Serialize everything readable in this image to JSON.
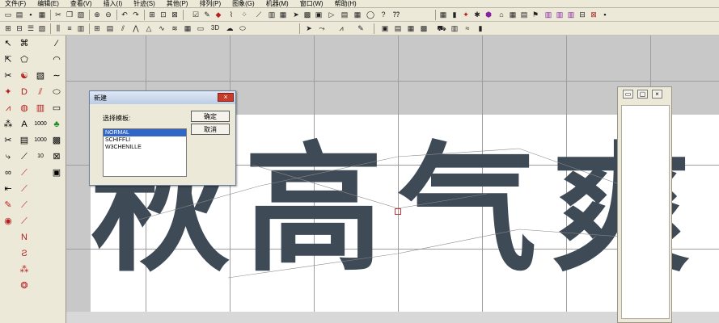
{
  "menu": [
    {
      "name": "menu-file",
      "label": "文件(F)"
    },
    {
      "name": "menu-edit",
      "label": "编辑(E)"
    },
    {
      "name": "menu-view",
      "label": "查看(V)"
    },
    {
      "name": "menu-insert",
      "label": "插入(I)"
    },
    {
      "name": "menu-stitch",
      "label": "针迹(S)"
    },
    {
      "name": "menu-other",
      "label": "其他(P)"
    },
    {
      "name": "menu-arrange",
      "label": "排列(P)"
    },
    {
      "name": "menu-image",
      "label": "图象(G)"
    },
    {
      "name": "menu-machine",
      "label": "机器(M)"
    },
    {
      "name": "menu-window",
      "label": "窗口(W)"
    },
    {
      "name": "menu-help",
      "label": "帮助(H)"
    }
  ],
  "toolbar2": {
    "threeD_label": "3D"
  },
  "lefttools": {
    "len_1000_a": "1000",
    "len_1000_b": "1000",
    "len_10": "10",
    "text_tool": "A"
  },
  "design": {
    "characters": [
      "秋",
      "高",
      "气",
      "爽"
    ],
    "thread_color": "#3f4a57"
  },
  "dialog": {
    "title": "新建",
    "close_label": "×",
    "label": "选择模板:",
    "ok_label": "确定",
    "cancel_label": "取消",
    "options": [
      "NORMAL",
      "SCHIFFLI",
      "W3CHENILLE"
    ],
    "selected": "NORMAL"
  },
  "panel": {
    "min_label": "▭",
    "max_label": "▢",
    "close_label": "×"
  },
  "icons": {
    "accent": "#3165c6",
    "close": "#c83b2a"
  }
}
